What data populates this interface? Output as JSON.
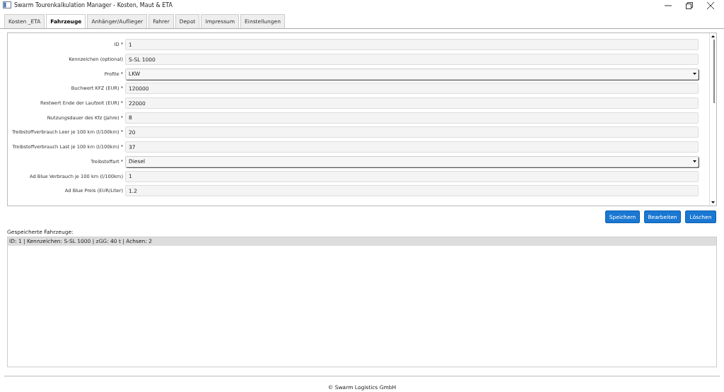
{
  "window": {
    "title": "Swarm Tourenkalkulation Manager - Kosten, Maut & ETA"
  },
  "tabs": [
    {
      "label": "Kosten _ETA",
      "selected": false
    },
    {
      "label": "Fahrzeuge",
      "selected": true
    },
    {
      "label": "Anhänger/Auflieger",
      "selected": false
    },
    {
      "label": "Fahrer",
      "selected": false
    },
    {
      "label": "Depot",
      "selected": false
    },
    {
      "label": "Impressum",
      "selected": false
    },
    {
      "label": "Einstellungen",
      "selected": false
    }
  ],
  "form": [
    {
      "label": "ID *",
      "value": "1",
      "kind": "text"
    },
    {
      "label": "Kennzeichen (optional)",
      "value": "S-SL 1000",
      "kind": "text"
    },
    {
      "label": "Profile *",
      "value": "LKW",
      "kind": "select"
    },
    {
      "label": "Buchwert KFZ (EUR) *",
      "value": "120000",
      "kind": "text"
    },
    {
      "label": "Restwert Ende der Laufzeit (EUR) *",
      "value": "22000",
      "kind": "text"
    },
    {
      "label": "Nutzungsdauer des Kfz (Jahre) *",
      "value": "8",
      "kind": "text"
    },
    {
      "label": "Treibstoffverbrauch Leer je 100 km (l/100km) *",
      "value": "20",
      "kind": "text"
    },
    {
      "label": "Treibstoffverbrauch Last je 100 km (l/100km) *",
      "value": "37",
      "kind": "text"
    },
    {
      "label": "Treibstoffart *",
      "value": "Diesel",
      "kind": "select"
    },
    {
      "label": "Ad Blue Verbrauch je 100 km (l/100km)",
      "value": "1",
      "kind": "text"
    },
    {
      "label": "Ad Blue Preis (EUR/Liter)",
      "value": "1.2",
      "kind": "text"
    }
  ],
  "buttons": [
    "Speichern",
    "Bearbeiten",
    "Löschen"
  ],
  "saved": {
    "label": "Gespeicherte Fahrzeuge:",
    "items": [
      {
        "text": "ID: 1 | Kennzeichen: S-SL 1000 | zGG: 40 t | Achsen: 2",
        "selected": true
      }
    ]
  },
  "footer": "© Swarm Logistics GmbH"
}
